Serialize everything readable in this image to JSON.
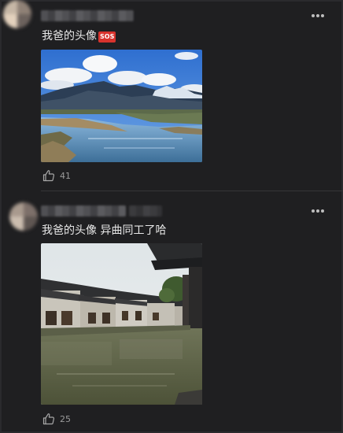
{
  "comments": [
    {
      "text": "我爸的头像",
      "badge": "SOS",
      "likes": "41",
      "photo_subject": "mountain-lake-landscape"
    },
    {
      "text": "我爸的头像 异曲同工了哈",
      "likes": "25",
      "photo_subject": "water-town-canal"
    }
  ],
  "icons": {
    "more": "more-dots-icon",
    "like": "thumbs-up-icon"
  },
  "colors": {
    "background": "#1f1f21",
    "text": "#e8e8e8",
    "muted": "#9a9a9a",
    "badge": "#d8332d"
  }
}
